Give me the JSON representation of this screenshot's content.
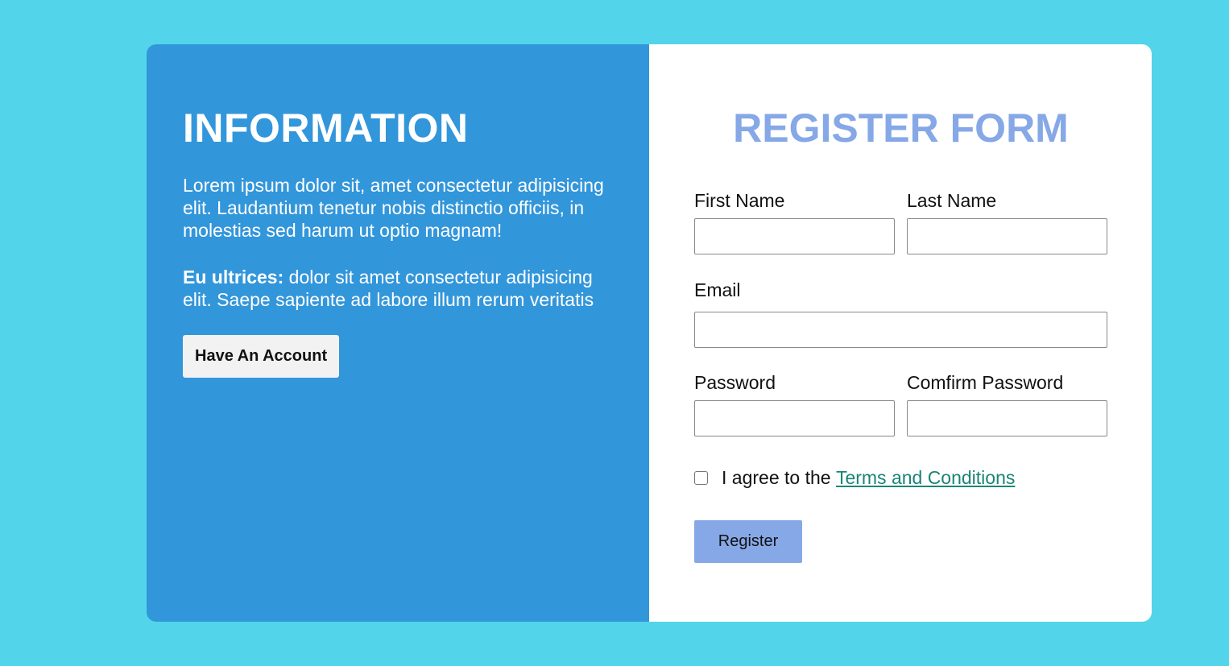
{
  "info": {
    "title": "INFORMATION",
    "paragraph1": "Lorem ipsum dolor sit, amet consectetur adipisicing elit. Laudantium tenetur nobis distinctio officiis, in molestias sed harum ut optio magnam!",
    "paragraph2_bold": "Eu ultrices:",
    "paragraph2_text": " dolor sit amet consectetur adipisicing elit. Saepe sapiente ad labore illum rerum veritatis",
    "account_button": "Have An Account"
  },
  "form": {
    "title": "REGISTER FORM",
    "first_name_label": "First Name",
    "first_name_value": "",
    "last_name_label": "Last Name",
    "last_name_value": "",
    "email_label": "Email",
    "email_value": "",
    "password_label": "Password",
    "password_value": "",
    "confirm_password_label": "Comfirm Password",
    "confirm_password_value": "",
    "agree_text": "I agree to the ",
    "terms_link": "Terms and Conditions",
    "agree_checked": false,
    "register_button": "Register"
  },
  "colors": {
    "page_background": "#52d5ea",
    "info_background": "#3296db",
    "form_title": "#86a8e7",
    "register_button": "#86a8e7",
    "terms_link": "#1a8577"
  }
}
